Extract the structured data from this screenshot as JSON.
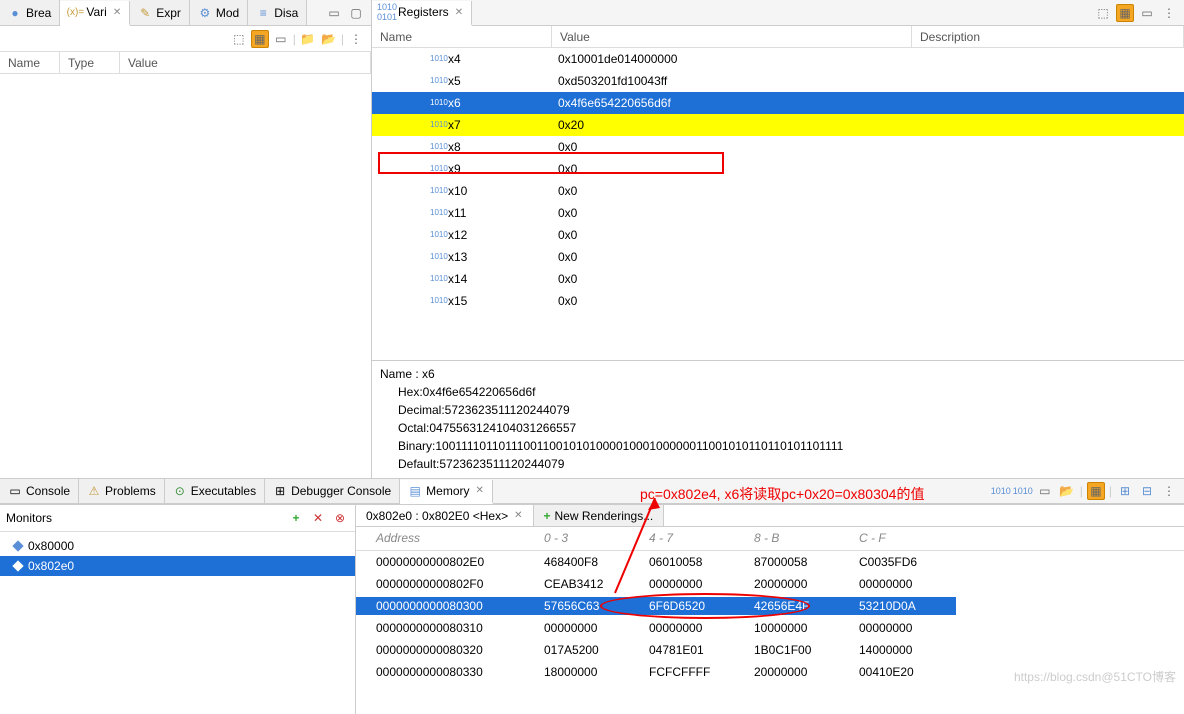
{
  "leftTop": {
    "tabs": [
      {
        "icon": "●",
        "label": "Brea"
      },
      {
        "icon": "(x)=",
        "label": "Vari",
        "active": true,
        "closable": true
      },
      {
        "icon": "✎",
        "label": "Expr"
      },
      {
        "icon": "⚙",
        "label": "Mod"
      },
      {
        "icon": "≡",
        "label": "Disa"
      }
    ],
    "columns": [
      "Name",
      "Type",
      "Value"
    ]
  },
  "registersTab": {
    "label": "Registers"
  },
  "regColumns": {
    "name": "Name",
    "value": "Value",
    "desc": "Description"
  },
  "registers": [
    {
      "name": "x4",
      "value": "0x10001de014000000"
    },
    {
      "name": "x5",
      "value": "0xd503201fd10043ff"
    },
    {
      "name": "x6",
      "value": "0x4f6e654220656d6f",
      "selected": true
    },
    {
      "name": "x7",
      "value": "0x20",
      "highlighted": true
    },
    {
      "name": "x8",
      "value": "0x0"
    },
    {
      "name": "x9",
      "value": "0x0"
    },
    {
      "name": "x10",
      "value": "0x0"
    },
    {
      "name": "x11",
      "value": "0x0"
    },
    {
      "name": "x12",
      "value": "0x0"
    },
    {
      "name": "x13",
      "value": "0x0"
    },
    {
      "name": "x14",
      "value": "0x0"
    },
    {
      "name": "x15",
      "value": "0x0"
    }
  ],
  "regDetail": {
    "nameLine": "Name : x6",
    "hex": "Hex:0x4f6e654220656d6f",
    "dec": "Decimal:5723623511120244079",
    "oct": "Octal:0475563124104031266557",
    "bin": "Binary:100111101101110011001010100001000100000011001010110110101101111",
    "def": "Default:5723623511120244079"
  },
  "bottomTabs": [
    {
      "icon": "▭",
      "label": "Console"
    },
    {
      "icon": "⚠",
      "label": "Problems"
    },
    {
      "icon": "⊙",
      "label": "Executables"
    },
    {
      "icon": "⊞",
      "label": "Debugger Console"
    },
    {
      "icon": "▤",
      "label": "Memory",
      "active": true,
      "closable": true
    }
  ],
  "monitorsLabel": "Monitors",
  "monitors": [
    {
      "addr": "0x80000"
    },
    {
      "addr": "0x802e0",
      "selected": true
    }
  ],
  "memTabs": [
    {
      "label": "0x802e0 : 0x802E0 <Hex>",
      "active": true,
      "closable": true
    },
    {
      "label": "New Renderings...",
      "plus": true
    }
  ],
  "memHeader": {
    "addr": "Address",
    "c0": "0 - 3",
    "c1": "4 - 7",
    "c2": "8 - B",
    "c3": "C - F"
  },
  "memRows": [
    {
      "addr": "00000000000802E0",
      "c": [
        "468400F8",
        "06010058",
        "87000058",
        "C0035FD6"
      ]
    },
    {
      "addr": "00000000000802F0",
      "c": [
        "CEAB3412",
        "00000000",
        "20000000",
        "00000000"
      ]
    },
    {
      "addr": "0000000000080300",
      "c": [
        "57656C63",
        "6F6D6520",
        "42656E4F",
        "53210D0A"
      ],
      "selected": true
    },
    {
      "addr": "0000000000080310",
      "c": [
        "00000000",
        "00000000",
        "10000000",
        "00000000"
      ]
    },
    {
      "addr": "0000000000080320",
      "c": [
        "017A5200",
        "04781E01",
        "1B0C1F00",
        "14000000"
      ]
    },
    {
      "addr": "0000000000080330",
      "c": [
        "18000000",
        "FCFCFFFF",
        "20000000",
        "00410E20"
      ]
    }
  ],
  "annotation": "pc=0x802e4, x6将读取pc+0x20=0x80304的值",
  "watermark": "https://blog.csdn@51CTO博客"
}
